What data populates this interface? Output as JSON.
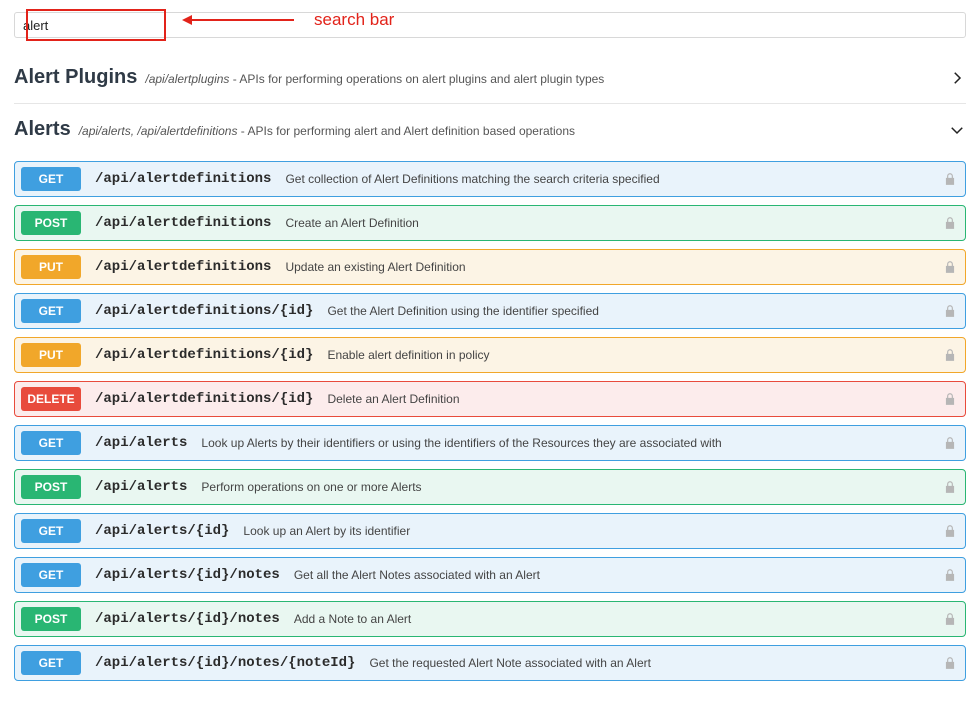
{
  "search": {
    "value": "alert"
  },
  "annotation": {
    "label": "search bar"
  },
  "sections": [
    {
      "key": "alertplugins",
      "title": "Alert Plugins",
      "subtitle_path": "/api/alertplugins",
      "subtitle_desc": " - APIs for performing operations on alert plugins and alert plugin types",
      "expanded": false
    },
    {
      "key": "alerts",
      "title": "Alerts",
      "subtitle_path": "/api/alerts, /api/alertdefinitions",
      "subtitle_desc": " - APIs for performing alert and Alert definition based operations",
      "expanded": true
    }
  ],
  "operations": [
    {
      "method": "GET",
      "cls": "get",
      "path": "/api/alertdefinitions",
      "summary": "Get collection of Alert Definitions matching the search criteria specified"
    },
    {
      "method": "POST",
      "cls": "post",
      "path": "/api/alertdefinitions",
      "summary": "Create an Alert Definition"
    },
    {
      "method": "PUT",
      "cls": "put",
      "path": "/api/alertdefinitions",
      "summary": "Update an existing Alert Definition"
    },
    {
      "method": "GET",
      "cls": "get",
      "path": "/api/alertdefinitions/{id}",
      "summary": "Get the Alert Definition using the identifier specified"
    },
    {
      "method": "PUT",
      "cls": "put",
      "path": "/api/alertdefinitions/{id}",
      "summary": "Enable alert definition in policy"
    },
    {
      "method": "DELETE",
      "cls": "delete",
      "path": "/api/alertdefinitions/{id}",
      "summary": "Delete an Alert Definition"
    },
    {
      "method": "GET",
      "cls": "get",
      "path": "/api/alerts",
      "summary": "Look up Alerts by their identifiers or using the identifiers of the Resources they are associated with"
    },
    {
      "method": "POST",
      "cls": "post",
      "path": "/api/alerts",
      "summary": "Perform operations on one or more Alerts"
    },
    {
      "method": "GET",
      "cls": "get",
      "path": "/api/alerts/{id}",
      "summary": "Look up an Alert by its identifier"
    },
    {
      "method": "GET",
      "cls": "get",
      "path": "/api/alerts/{id}/notes",
      "summary": "Get all the Alert Notes associated with an Alert"
    },
    {
      "method": "POST",
      "cls": "post",
      "path": "/api/alerts/{id}/notes",
      "summary": "Add a Note to an Alert"
    },
    {
      "method": "GET",
      "cls": "get",
      "path": "/api/alerts/{id}/notes/{noteId}",
      "summary": "Get the requested Alert Note associated with an Alert"
    }
  ]
}
